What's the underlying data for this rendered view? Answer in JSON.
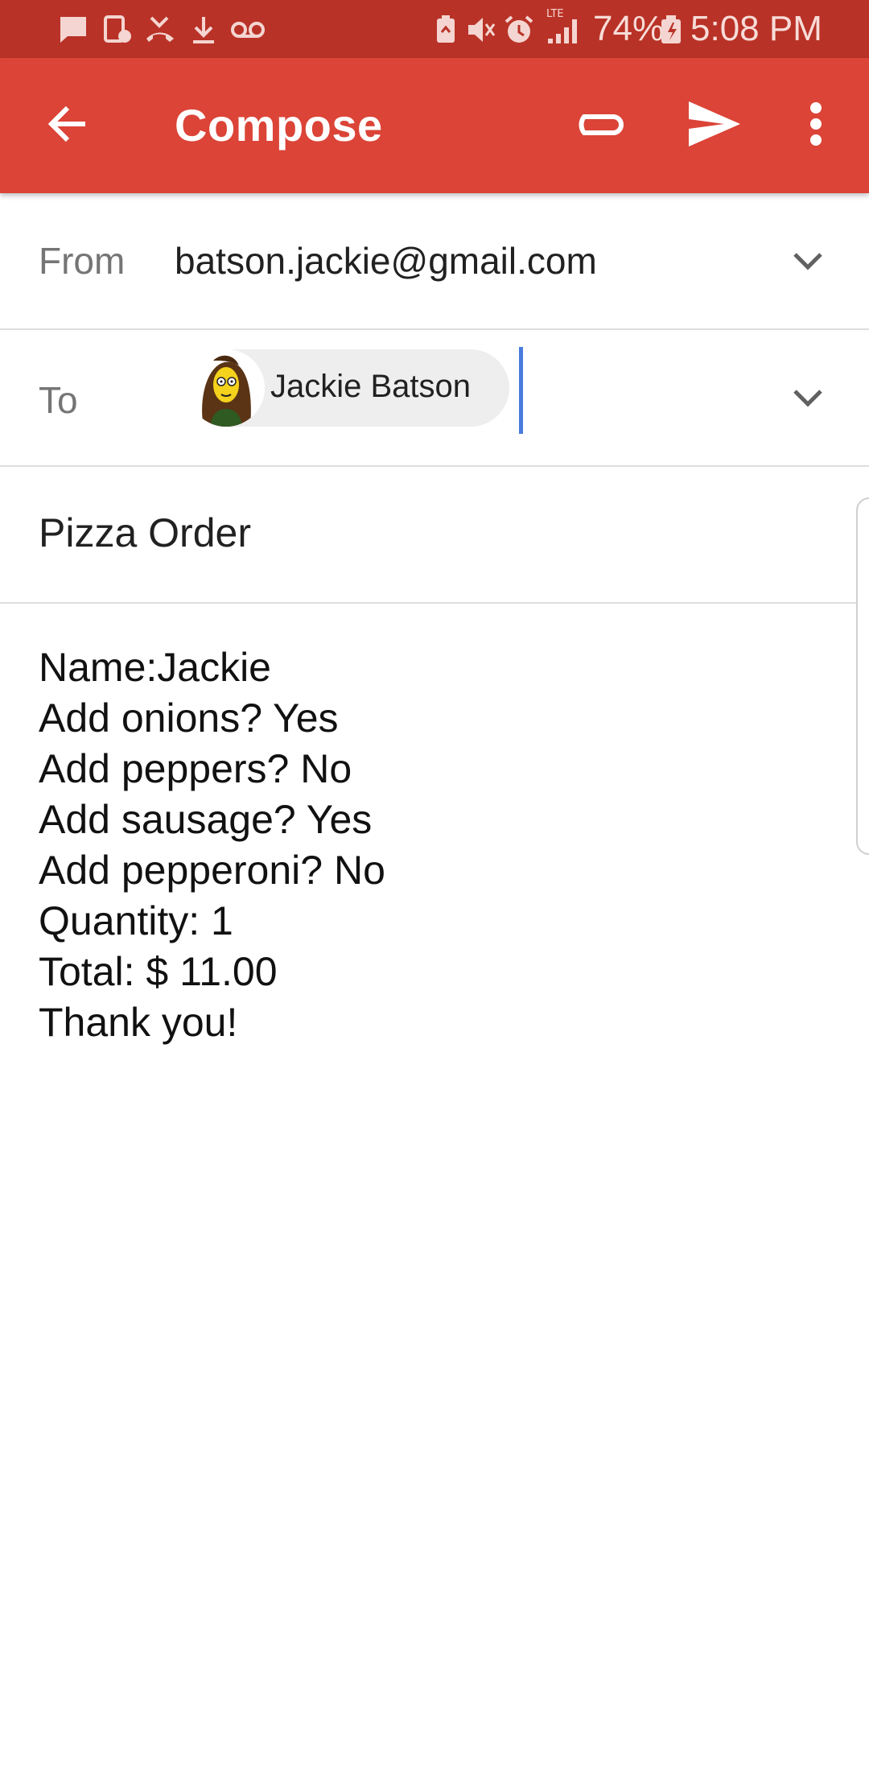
{
  "status_bar": {
    "battery": "74%",
    "time": "5:08 PM",
    "network": "LTE",
    "icons": [
      "message-icon",
      "screen-record-icon",
      "missed-call-icon",
      "download-icon",
      "voicemail-icon",
      "battery-saver-icon",
      "mute-icon",
      "alarm-icon",
      "signal-icon",
      "battery-icon"
    ]
  },
  "app_bar": {
    "title": "Compose",
    "icons": [
      "back-arrow-icon",
      "attach-icon",
      "send-icon",
      "more-vert-icon"
    ],
    "color": "#db4437"
  },
  "from": {
    "label": "From",
    "value": "batson.jackie@gmail.com"
  },
  "to": {
    "label": "To",
    "recipient": "Jackie Batson"
  },
  "subject": {
    "value": "Pizza Order"
  },
  "body": {
    "lines": [
      "Name:Jackie",
      "Add onions? Yes",
      "Add peppers? No",
      "Add sausage? Yes",
      "Add pepperoni? No",
      "Quantity: 1",
      "Total: $ 11.00",
      "Thank you!"
    ]
  }
}
